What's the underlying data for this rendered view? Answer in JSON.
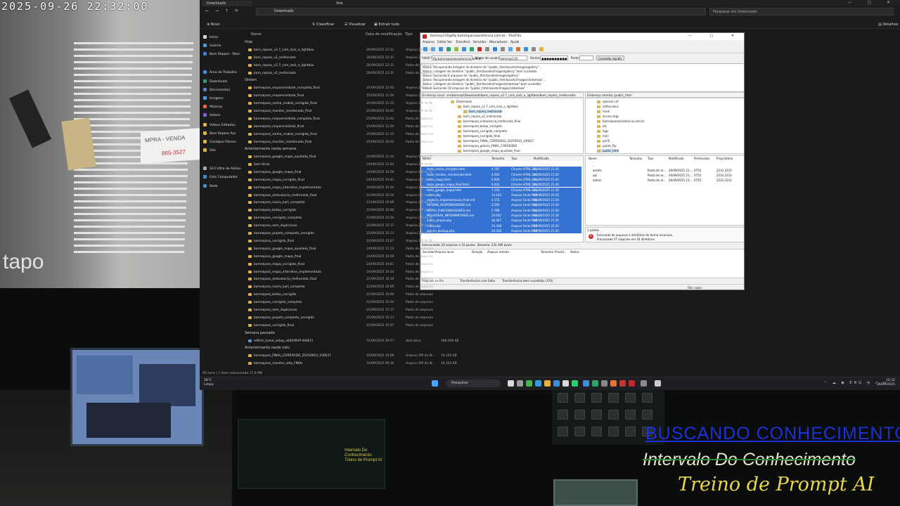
{
  "camera": {
    "timestamp": "2025-09-26 22:32:00",
    "brand": "tapo",
    "sign_line1": "MPRA - VENDA",
    "sign_line2": "865-3527"
  },
  "overlay": {
    "line1": "BUSCANDO CONHECIMENTO",
    "line2": "Intervalo Do Conhecimento",
    "line3": "Treino de Prompt AI"
  },
  "studio": {
    "monitor_text": [
      "Intervalo Do Conhecimento",
      "Treino de Prompt AI"
    ]
  },
  "explorer": {
    "tabs": [
      "Downloads",
      "Site"
    ],
    "address": "Downloads",
    "search_placeholder": "Pesquisar em Downloads",
    "toolbar": {
      "new": "Novo",
      "sort": "Classificar",
      "view": "Visualizar",
      "extract": "Extrair tudo",
      "details": "Detalhes"
    },
    "nav": [
      {
        "label": "Início",
        "color": "#d9d9d9"
      },
      {
        "label": "Galeria",
        "color": "#3aa0e8"
      },
      {
        "label": "Bom Reparo - Pess",
        "color": "#2f84d8"
      },
      {
        "label": "Área de Trabalho",
        "color": "#3a8fd8"
      },
      {
        "label": "Downloads",
        "color": "#2fa36f"
      },
      {
        "label": "Documentos",
        "color": "#5b7bd8"
      },
      {
        "label": "Imagens",
        "color": "#3aa0e8"
      },
      {
        "label": "Músicas",
        "color": "#e86a3a"
      },
      {
        "label": "Vídeos",
        "color": "#8a5ad8"
      },
      {
        "label": "Vídeos Editados",
        "color": "#e4b33f"
      },
      {
        "label": "Bom Reparo Ass",
        "color": "#e4b33f"
      },
      {
        "label": "Cardápio Fitness",
        "color": "#e4b33f"
      },
      {
        "label": "Site",
        "color": "#e4b33f"
      },
      {
        "label": "S23 Ultra de Adrian",
        "color": "#aaaaaa"
      },
      {
        "label": "Este Computador",
        "color": "#3a8fd8"
      },
      {
        "label": "Rede",
        "color": "#3a8fd8"
      }
    ],
    "columns": {
      "name": "Nome",
      "date": "Data de modificação",
      "type": "Tipo"
    },
    "groups": [
      "Hoje",
      "Ontem",
      "Anteriormente nesta semana",
      "Semana passada",
      "Anteriormente neste mês"
    ],
    "files": [
      {
        "name": "bom_reparo_v2.7_com_lock_e_lightbox",
        "date": "26/09/2025 22:31",
        "type": "Arquivo ZIP do W..."
      },
      {
        "name": "bom_reparo_v2_melhorado",
        "date": "26/09/2025 22:31",
        "type": "Arquivo ZIP do W..."
      },
      {
        "name": "bom_reparo_v2.7_com_lock_e_lightbox",
        "date": "26/09/2025 22:31",
        "type": "Pasta de arquivos"
      },
      {
        "name": "bom_reparo_v2_melhorado",
        "date": "26/09/2025 22:31",
        "type": "Pasta de arquivos"
      },
      {
        "name": "bomreparo_responsividade_completa_final",
        "date": "25/09/2025 12:02",
        "type": "Arquivo ZIP do W..."
      },
      {
        "name": "bomreparo_responsividade_final",
        "date": "25/09/2025 11:20",
        "type": "Arquivo ZIP do W..."
      },
      {
        "name": "bomreparo_senha_mobile_corrigida_final",
        "date": "25/09/2025 11:15",
        "type": "Arquivo ZIP do W..."
      },
      {
        "name": "bomreparo_monitor_reordenado_final",
        "date": "25/09/2025 10:02",
        "type": "Arquivo ZIP do W..."
      },
      {
        "name": "bomreparo_responsividade_completa_final",
        "date": "25/09/2025 12:02",
        "type": "Pasta de arquivos"
      },
      {
        "name": "bomreparo_responsividade_final",
        "date": "25/09/2025 11:20",
        "type": "Pasta de arquivos"
      },
      {
        "name": "bomreparo_senha_mobile_corrigida_final",
        "date": "25/09/2025 11:15",
        "type": "Pasta de arquivos"
      },
      {
        "name": "bomreparo_monitor_reordenado_final",
        "date": "25/09/2025 10:02",
        "type": "Pasta de arquivos"
      },
      {
        "name": "bomreparo_google_mapa_ajustado_final",
        "date": "24/09/2025 11:14",
        "type": "Arquivo ZIP do W..."
      },
      {
        "name": "Sem título",
        "date": "24/09/2025 11:04",
        "type": "Arquivo ZIP do W..."
      },
      {
        "name": "bomreparo_google_mapa_final",
        "date": "24/09/2025 10:59",
        "type": "Arquivo ZIP do W..."
      },
      {
        "name": "bomreparo_mapa_corrigido_final",
        "date": "24/09/2025 10:41",
        "type": "Arquivo ZIP do W..."
      },
      {
        "name": "bomreparo_mapa_interativo_implementado",
        "date": "24/09/2025 10:20",
        "type": "Arquivo ZIP do W..."
      },
      {
        "name": "bomreparo_ambulancia_melhorada_final",
        "date": "22/09/2025 16:10",
        "type": "Arquivo ZIP do W..."
      },
      {
        "name": "bomreparo_mario_kart_completo",
        "date": "22/09/2025 16:06",
        "type": "Arquivo ZIP do W..."
      },
      {
        "name": "bomreparo_botao_corrigido",
        "date": "22/09/2025 16:00",
        "type": "Arquivo ZIP do W..."
      },
      {
        "name": "bomreparo_corrigido_completo",
        "date": "22/09/2025 15:30",
        "type": "Arquivo ZIP do W..."
      },
      {
        "name": "bomreparo_sem_duplicacao",
        "date": "22/09/2025 15:17",
        "type": "Arquivo ZIP do W..."
      },
      {
        "name": "bomreparo_projeto_completo_corrigido",
        "date": "22/09/2025 15:13",
        "type": "Arquivo ZIP do W..."
      },
      {
        "name": "bomreparo_corrigido_final",
        "date": "22/09/2025 15:07",
        "type": "Arquivo ZIP do W..."
      },
      {
        "name": "bomreparo_google_mapa_ajustado_final",
        "date": "24/09/2025 11:14",
        "type": "Pasta de arquivos"
      },
      {
        "name": "bomreparo_google_mapa_final",
        "date": "24/09/2025 10:59",
        "type": "Pasta de arquivos"
      },
      {
        "name": "bomreparo_mapa_corrigido_final",
        "date": "24/09/2025 10:41",
        "type": "Pasta de arquivos"
      },
      {
        "name": "bomreparo_mapa_interativo_implementado",
        "date": "24/09/2025 10:20",
        "type": "Pasta de arquivos"
      },
      {
        "name": "bomreparo_ambulancia_melhorada_final",
        "date": "22/09/2025 16:10",
        "type": "Pasta de arquivos"
      },
      {
        "name": "bomreparo_mario_kart_completo",
        "date": "22/09/2025 16:06",
        "type": "Pasta de arquivos"
      },
      {
        "name": "bomreparo_botao_corrigido",
        "date": "22/09/2025 16:00",
        "type": "Pasta de arquivos"
      },
      {
        "name": "bomreparo_corrigido_completo",
        "date": "22/09/2025 15:30",
        "type": "Pasta de arquivos"
      },
      {
        "name": "bomreparo_sem_duplicacao",
        "date": "22/09/2025 15:17",
        "type": "Pasta de arquivos"
      },
      {
        "name": "bomreparo_projeto_completo_corrigido",
        "date": "22/09/2025 15:13",
        "type": "Pasta de arquivos"
      },
      {
        "name": "bomreparo_corrigido_final",
        "date": "22/09/2025 15:07",
        "type": "Pasta de arquivos"
      },
      {
        "name": "reflect_home_setup_v64[HRVP-444EY]",
        "date": "15/09/2025 20:57",
        "type": "Aplicativo",
        "size": "288.006 KB"
      },
      {
        "name": "bomreparo_FINAL_CORRIGIDO_20250910_100637",
        "date": "10/09/2025 10:08",
        "type": "Arquivo ZIP do W...",
        "size": "19.192 KB"
      },
      {
        "name": "bomreparo_monitor_vida_FINAL",
        "date": "10/09/2025 09:16",
        "type": "Arquivo ZIP do W...",
        "size": "18.203 KB"
      }
    ],
    "status": "66 itens  |  1 item selecionado  17,8 MB"
  },
  "filezilla": {
    "title": "bomrep110@ftp.bomreparoassistencia.com.br - FileZilla",
    "menu": [
      "Arquivo",
      "Editar",
      "Ver",
      "Transferir",
      "Servidor",
      "Marcadores",
      "Ajuda"
    ],
    "quickconnect": {
      "host_label": "Host:",
      "host": "ftp.bomreparoassistencia.com.br",
      "user_label": "Nome de usuário:",
      "user": "bomrep110",
      "pass_label": "Senha:",
      "pass": "●●●●●●●●●●",
      "port_label": "Porta:",
      "button": "Conexão rápida"
    },
    "log": [
      "Status:  Recuperando listagem do diretório de \"/public_html/assets/images/gallery\"...",
      "Status:  Listagem do diretório \"/public_html/assets/images/gallery\" bem sucedida",
      "Status:  Excluindo 6 arquivos de \"/public_html/assets/images/gallery\"",
      "Status:  Recuperando listagem do diretório de \"/public_html/assets/images/slideshow\"...",
      "Status:  Listagem do diretório \"/public_html/assets/images/slideshow\" bem sucedida",
      "Status:  Excluindo 10 arquivos de \"/public_html/assets/images/slideshow\""
    ],
    "local_label": "Endereço local:",
    "local_path": "ers\\bomrep\\Downloads\\bom_reparo_v2.7_com_lock_e_lightbox\\bom_reparo_melhorado\\",
    "remote_label": "Endereço remoto:",
    "remote_path": "/public_html",
    "local_tree": [
      "Downloads",
      "bom_reparo_v2.7_com_lock_e_lightbox",
      "bom_reparo_melhorado",
      "bom_reparo_v2_melhorado",
      "bomreparo_ambulancia_melhorada_final",
      "bomreparo_botao_corrigido",
      "bomreparo_corrigido_completo",
      "bomreparo_corrigido_final",
      "bomreparo_FINAL_CORRIGIDO_20250910_100637",
      "bomreparo_galeria_FINAL_CORRIGIDO",
      "bomreparo_google_mapa_ajustado_final"
    ],
    "remote_tree": [
      "openssl.cnf",
      "softaculous",
      "trash",
      "access-logs",
      "bomreparoassistencia.com.br",
      "etc",
      "logs",
      "mail",
      "perl5",
      "public_ftp",
      "public_html"
    ],
    "local_cols": [
      "Nome",
      "Tamanho",
      "Tipo",
      "Modificado"
    ],
    "remote_cols": [
      "Nome",
      "Tamanho",
      "Tipo",
      "Modificado",
      "Permissões",
      "Proprietário"
    ],
    "local_files": [
      {
        "n": "..",
        "s": "",
        "t": "",
        "m": ""
      },
      {
        "n": "teste_senha_corrigida.html",
        "s": "4.787",
        "t": "Chrome HTML Do...",
        "m": "26/09/2025 21:30"
      },
      {
        "n": "teste_monitor_reordenado.html",
        "s": "4.062",
        "t": "Chrome HTML Do...",
        "m": "26/09/2025 21:30"
      },
      {
        "n": "teste_mapa.html",
        "s": "6.926",
        "t": "Chrome HTML Do...",
        "m": "26/09/2025 21:30"
      },
      {
        "n": "teste_google_mapa_final.html",
        "s": "6.624",
        "t": "Chrome HTML Do...",
        "m": "26/09/2025 21:30"
      },
      {
        "n": "teste_google_mapa.html",
        "s": "7.143",
        "t": "Chrome HTML Do...",
        "m": "26/09/2025 21:30"
      },
      {
        "n": "sobre.php",
        "s": "14.422",
        "t": "Arquivo Fonte PHP",
        "m": "26/09/2025 22:20"
      },
      {
        "n": "relatorio_implementacao_final.md",
        "s": "4.155",
        "t": "Arquivo Fonte Mar...",
        "m": "26/09/2025 21:30"
      },
      {
        "n": "README_RESPONSIVIDADE.md",
        "s": "2.285",
        "t": "Arquivo Fonte Mar...",
        "m": "26/09/2025 21:30"
      },
      {
        "n": "NOVAS_FUNCIONALIDADES.md",
        "s": "5.786",
        "t": "Arquivo Fonte Mar...",
        "m": "26/09/2025 21:30"
      },
      {
        "n": "MELHORIAS_IMPLEMENTADAS.md",
        "s": "10.642",
        "t": "Arquivo Fonte Mar...",
        "m": "26/09/2025 21:34"
      },
      {
        "n": "index_simple.php",
        "s": "30.447",
        "t": "Arquivo Fonte PHP",
        "m": "26/09/2025 21:30"
      },
      {
        "n": "index.php",
        "s": "23.348",
        "t": "Arquivo Fonte PHP",
        "m": "26/09/2025 22:20"
      },
      {
        "n": "galeria_backup.php",
        "s": "24.348",
        "t": "Arquivo Fonte PHP",
        "m": "26/09/2025 21:30"
      }
    ],
    "remote_files": [
      {
        "n": "..",
        "t": "",
        "m": "",
        "p": "",
        "o": ""
      },
      {
        "n": "assets",
        "t": "Pasta de ar...",
        "m": "26/09/2025 21:...",
        "p": "0755",
        "o": "2233 2233"
      },
      {
        "n": "api",
        "t": "Pasta de ar...",
        "m": "26/09/2025 21:...",
        "p": "0755",
        "o": "2233 2233"
      },
      {
        "n": "admin",
        "t": "Pasta de ar...",
        "m": "26/09/2025 21:...",
        "p": "0755",
        "o": "2233 2233"
      }
    ],
    "local_status": "Selecionados 20 arquivos e 10 pastas. Tamanho: 232.396 bytes",
    "remote_status": "3 pastas",
    "remote_log": [
      "Excluindo de arquivos e diretórios de forma recursiva.",
      "Processado 57 arquivos em 16 diretórios."
    ],
    "queue_cols": [
      "Servidor/Arquivo local",
      "Direção",
      "Arquivo remoto",
      "Tamanho",
      "Priorid...",
      "Status"
    ],
    "tabs": [
      "Arquivos na fila",
      "Transferências com falha",
      "Transferências bem sucedidas (370)"
    ],
    "queue_status": "Fila: vazia"
  },
  "taskbar": {
    "weather_temp": "28°C",
    "weather_desc": "Limpo",
    "search": "Pesquisar",
    "lang": "ENG",
    "time": "22:32",
    "date": "26/09/2025",
    "icons": [
      {
        "name": "start",
        "color": "#4aa3ff"
      },
      {
        "name": "taskview",
        "color": "#d9d9d9"
      },
      {
        "name": "files",
        "color": "#9a9a9a"
      },
      {
        "name": "chrome",
        "color": "#4caf50"
      },
      {
        "name": "edge",
        "color": "#2f9ee8"
      },
      {
        "name": "explorer",
        "color": "#e4b33f"
      },
      {
        "name": "store",
        "color": "#3a8fd8"
      },
      {
        "name": "terminal",
        "color": "#d9d9d9"
      },
      {
        "name": "whatsapp",
        "color": "#25d366"
      },
      {
        "name": "app-blue",
        "color": "#3a8fd8"
      },
      {
        "name": "app-green",
        "color": "#2fa36f"
      },
      {
        "name": "app-gray",
        "color": "#888888"
      },
      {
        "name": "app-orange",
        "color": "#e8733a"
      },
      {
        "name": "app-red",
        "color": "#c9332c"
      },
      {
        "name": "filezilla",
        "color": "#bf2a2a"
      },
      {
        "name": "settings",
        "color": "#8a8a8a"
      },
      {
        "name": "obs",
        "color": "#cccccc"
      }
    ]
  }
}
